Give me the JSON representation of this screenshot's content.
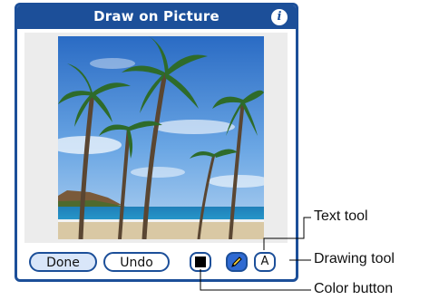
{
  "window": {
    "title": "Draw on Picture",
    "info_icon": "info-icon",
    "info_glyph": "i",
    "accent_color": "#1c4f99"
  },
  "toolbar": {
    "done_label": "Done",
    "undo_label": "Undo",
    "color_swatch": "#000000",
    "drawing_tool_icon": "pencil-icon",
    "text_tool_glyph": "A"
  },
  "callouts": {
    "text_tool": "Text tool",
    "drawing_tool": "Drawing tool",
    "color_button": "Color button"
  }
}
